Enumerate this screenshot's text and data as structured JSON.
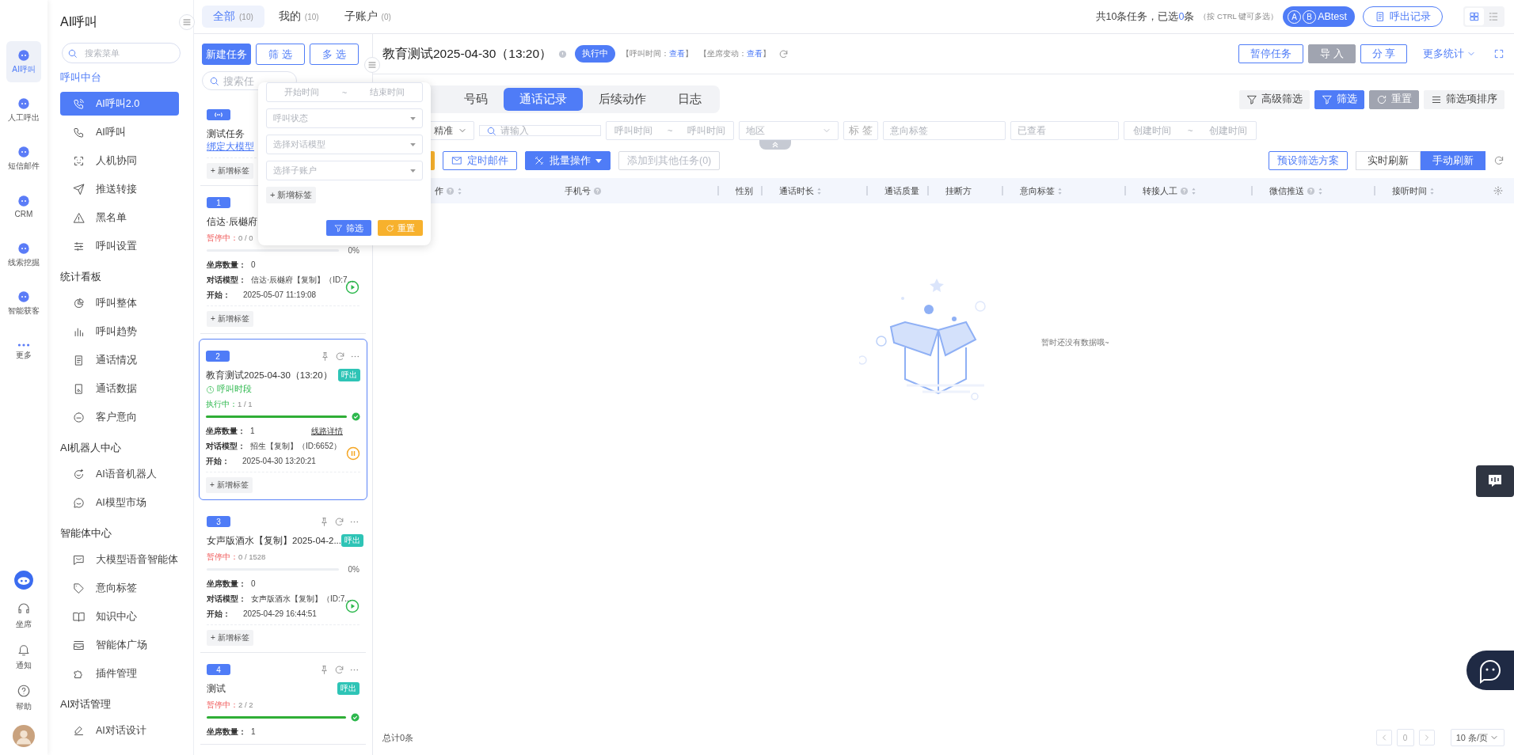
{
  "rail": {
    "items": [
      {
        "label": "AI呼叫",
        "selected": true
      },
      {
        "label": "人工呼出",
        "selected": false
      },
      {
        "label": "短信邮件",
        "selected": false
      },
      {
        "label": "CRM",
        "selected": false
      },
      {
        "label": "线索挖掘",
        "selected": false
      },
      {
        "label": "智能获客",
        "selected": false
      },
      {
        "label": "更多",
        "selected": false
      }
    ],
    "bottom": [
      {
        "label": "坐席"
      },
      {
        "label": "通知"
      },
      {
        "label": "帮助"
      }
    ]
  },
  "menu": {
    "title": "AI呼叫",
    "search_placeholder": "搜索菜单",
    "sections": [
      {
        "title": "呼叫中台",
        "active": true,
        "items": [
          {
            "label": "AI呼叫2.0",
            "selected": true
          },
          {
            "label": "AI呼叫",
            "selected": false
          },
          {
            "label": "人机协同",
            "selected": false
          },
          {
            "label": "推送转接",
            "selected": false
          },
          {
            "label": "黑名单",
            "selected": false
          },
          {
            "label": "呼叫设置",
            "selected": false
          }
        ]
      },
      {
        "title": "统计看板",
        "active": false,
        "items": [
          {
            "label": "呼叫整体",
            "selected": false
          },
          {
            "label": "呼叫趋势",
            "selected": false
          },
          {
            "label": "通话情况",
            "selected": false
          },
          {
            "label": "通话数据",
            "selected": false
          },
          {
            "label": "客户意向",
            "selected": false
          }
        ]
      },
      {
        "title": "AI机器人中心",
        "active": false,
        "items": [
          {
            "label": "AI语音机器人",
            "selected": false
          },
          {
            "label": "AI模型市场",
            "selected": false
          }
        ]
      },
      {
        "title": "智能体中心",
        "active": false,
        "items": [
          {
            "label": "大模型语音智能体",
            "selected": false
          },
          {
            "label": "意向标签",
            "selected": false
          },
          {
            "label": "知识中心",
            "selected": false
          },
          {
            "label": "智能体广场",
            "selected": false
          },
          {
            "label": "插件管理",
            "selected": false
          }
        ]
      },
      {
        "title": "AI对话管理",
        "active": false,
        "items": [
          {
            "label": "AI对话设计",
            "selected": false
          }
        ]
      }
    ]
  },
  "top_bar": {
    "tabs": [
      {
        "label": "全部",
        "count": "(10)",
        "selected": true
      },
      {
        "label": "我的",
        "count": "(10)",
        "selected": false
      },
      {
        "label": "子账户",
        "count": "(0)",
        "selected": false
      }
    ],
    "summary_before": "共10条任务，已选",
    "selected_count": "0",
    "summary_after": "条",
    "hint": "（按 CTRL 键可多选）",
    "ab_letters": [
      "A",
      "B"
    ],
    "ab_button": "ABtest",
    "records_button": "呼出记录",
    "view_modes": [
      {
        "selected": true
      },
      {
        "selected": false
      }
    ]
  },
  "task_list": {
    "buttons": [
      "新建任务",
      "筛 选",
      "多 选"
    ],
    "search_placeholder": "搜索任",
    "tasks": [
      {
        "kind": "signal",
        "title": "测试任务",
        "link": "绑定大模型",
        "tag_button": "+ 新增标签",
        "selected": false
      },
      {
        "kind": "numbered",
        "number": "1",
        "title": "信达·辰樾府",
        "selected": false,
        "running": false,
        "status": {
          "label": "暂停中：",
          "value": "0 / 0"
        },
        "progress": {
          "level": 0,
          "percent": "0%"
        },
        "seats": {
          "label": "坐席数量：",
          "value": "0"
        },
        "model": {
          "label": "对话模型：",
          "value": "信达·辰樾府【复制】（ID:7..."
        },
        "start": {
          "label": "开始：",
          "value": "2025-05-07 11:19:08"
        },
        "tag_button": "+ 新增标签"
      },
      {
        "kind": "numbered",
        "number": "2",
        "title": "教育测试2025-04-30（13:20）",
        "direction": "呼出",
        "schedule": "呼叫时段",
        "selected": true,
        "actions": true,
        "running": true,
        "status": {
          "label": "执行中：",
          "value": "1 / 1"
        },
        "progress": {
          "level": 1,
          "done": true
        },
        "seats": {
          "label": "坐席数量：",
          "value": "1"
        },
        "line_link": "线路详情",
        "model": {
          "label": "对话模型：",
          "value": "招生【复制】（ID:6652）"
        },
        "start": {
          "label": "开始：",
          "value": "2025-04-30 13:20:21"
        },
        "tag_button": "+ 新增标签"
      },
      {
        "kind": "numbered",
        "number": "3",
        "title": "女声版酒水【复制】2025-04-2...",
        "direction": "呼出",
        "selected": false,
        "actions": true,
        "running": false,
        "status": {
          "label": "暂停中：",
          "value": "0 / 1528"
        },
        "progress": {
          "level": 0,
          "percent": "0%"
        },
        "seats": {
          "label": "坐席数量：",
          "value": "0"
        },
        "model": {
          "label": "对话模型：",
          "value": "女声版酒水【复制】（ID:7..."
        },
        "start": {
          "label": "开始：",
          "value": "2025-04-29 16:44:51"
        },
        "tag_button": "+ 新增标签"
      },
      {
        "kind": "numbered",
        "number": "4",
        "title": "测试",
        "direction": "呼出",
        "selected": false,
        "actions": true,
        "running": false,
        "status": {
          "label": "暂停中：",
          "value": "2 / 2"
        },
        "progress": {
          "level": 1,
          "done": true
        },
        "seats": {
          "label": "坐席数量：",
          "value": "1"
        }
      }
    ]
  },
  "filter_popup": {
    "start_placeholder": "开始时间",
    "separator": "~",
    "end_placeholder": "结束时间",
    "selects": [
      "呼叫状态",
      "选择对话模型",
      "选择子账户"
    ],
    "tag_button": "+ 新增标签",
    "filter_button": "筛选",
    "reset_button": "重置"
  },
  "task_header": {
    "title": "教育测试2025-04-30（13:20）",
    "status": "执行中",
    "meta": [
      {
        "label": "【呼叫时间：",
        "link": "查看",
        "end": "】"
      },
      {
        "label": "【坐席变动：",
        "link": "查看",
        "end": "】"
      }
    ],
    "buttons": [
      {
        "label": "暂停任务",
        "kind": "outline"
      },
      {
        "label": "导 入",
        "kind": "grey"
      },
      {
        "label": "分 享",
        "kind": "outline"
      }
    ],
    "more_stats": "更多统计"
  },
  "tabs": [
    {
      "label": "号码",
      "selected": false
    },
    {
      "label": "通话记录",
      "selected": true
    },
    {
      "label": "后续动作",
      "selected": false
    },
    {
      "label": "日志",
      "selected": false
    }
  ],
  "filter_actions": [
    {
      "label": "高级筛选",
      "kind": "plain"
    },
    {
      "label": "筛选",
      "kind": "primary"
    },
    {
      "label": "重置",
      "kind": "grey"
    },
    {
      "label": "筛选项排序",
      "kind": "plain"
    }
  ],
  "filters": {
    "match": "精准",
    "search_placeholder": "请输入",
    "call_time": [
      "呼叫时间",
      "~",
      "呼叫时间"
    ],
    "region": "地区",
    "tag_button": "标 签",
    "intent_placeholder": "意向标签",
    "viewed_placeholder": "已查看",
    "created_time": [
      "创建时间",
      "~",
      "创建时间"
    ]
  },
  "actions": {
    "mail_button": "定时邮件",
    "batch_button": "批量操作",
    "add_button": "添加到其他任务(0)",
    "add_disabled": true,
    "preset_button": "预设筛选方案",
    "refresh_modes": [
      {
        "label": "实时刷新",
        "selected": false
      },
      {
        "label": "手动刷新",
        "selected": true
      }
    ]
  },
  "table": {
    "columns": [
      {
        "label": "作",
        "help": true,
        "sortable": true
      },
      {
        "label": "手机号",
        "help": true,
        "sortable": false
      },
      {
        "label": "性别",
        "help": false,
        "sortable": false
      },
      {
        "label": "通话时长",
        "help": false,
        "sortable": true
      },
      {
        "label": "通话质量",
        "help": false,
        "sortable": false
      },
      {
        "label": "挂断方",
        "help": false,
        "sortable": false
      },
      {
        "label": "意向标签",
        "help": false,
        "sortable": true
      },
      {
        "label": "转接人工",
        "help": true,
        "sortable": true
      },
      {
        "label": "微信推送",
        "help": true,
        "sortable": true
      },
      {
        "label": "接听时间",
        "help": false,
        "sortable": true
      }
    ],
    "empty_text": "暂时还没有数据哦~"
  },
  "footer": {
    "total": "总计0条",
    "page": "0",
    "page_size": "10 条/页"
  }
}
